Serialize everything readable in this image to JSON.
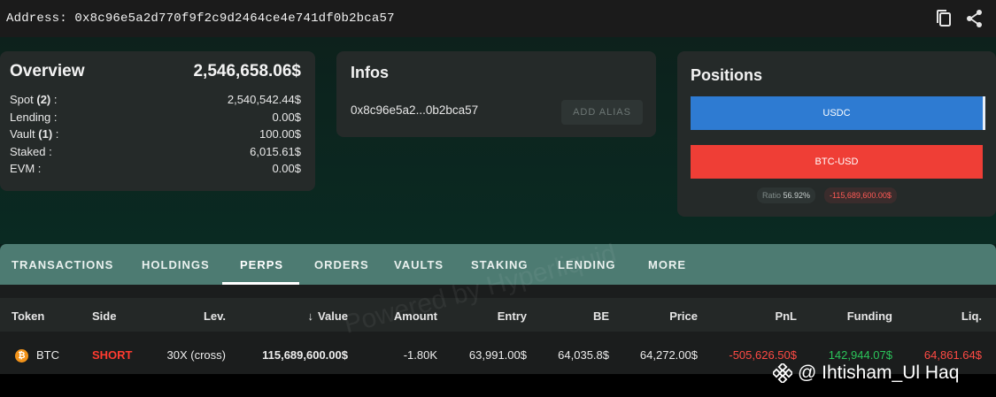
{
  "header": {
    "address_label": "Address:",
    "address": "0x8c96e5a2d770f9f2c9d2464ce4e741df0b2bca57",
    "icons": [
      "copy-icon",
      "share-icon"
    ]
  },
  "overview": {
    "title": "Overview",
    "total": "2,546,658.06$",
    "rows": [
      {
        "label": "Spot",
        "count": "(2)",
        "suffix": " :",
        "value": "2,540,542.44$"
      },
      {
        "label": "Lending",
        "count": "",
        "suffix": " :",
        "value": "0.00$"
      },
      {
        "label": "Vault",
        "count": "(1)",
        "suffix": " :",
        "value": "100.00$"
      },
      {
        "label": "Staked",
        "count": "",
        "suffix": " :",
        "value": "6,015.61$"
      },
      {
        "label": "EVM",
        "count": "",
        "suffix": " :",
        "value": "0.00$"
      }
    ]
  },
  "infos": {
    "title": "Infos",
    "short_address": "0x8c96e5a2...0b2bca57",
    "add_alias_label": "ADD ALIAS"
  },
  "positions": {
    "title": "Positions",
    "bars": [
      "USDC",
      "BTC-USD"
    ],
    "ratio_label": "Ratio",
    "ratio_value": "56.92%",
    "net_value": "-115,689,600.00$"
  },
  "tabs": [
    "TRANSACTIONS",
    "HOLDINGS",
    "PERPS",
    "ORDERS",
    "VAULTS",
    "STAKING",
    "LENDING",
    "MORE"
  ],
  "active_tab": "PERPS",
  "table": {
    "columns": [
      "Token",
      "Side",
      "Lev.",
      "Value",
      "Amount",
      "Entry",
      "BE",
      "Price",
      "PnL",
      "Funding",
      "Liq."
    ],
    "sort_arrow": "↓",
    "rows": [
      {
        "token": "BTC",
        "side": "SHORT",
        "lev": "30X (cross)",
        "value": "115,689,600.00$",
        "amount": "-1.80K",
        "entry": "63,991.00$",
        "be": "64,035.8$",
        "price": "64,272.00$",
        "pnl": "-505,626.50$",
        "funding": "142,944.07$",
        "liq": "64,861.64$"
      }
    ]
  },
  "watermark": "Powered by Hyperliquid",
  "credit": "@ Ihtisham_Ul Haq",
  "colors": {
    "accent_tab": "#4d7b72",
    "usdc": "#2e7bd2",
    "btc": "#ef3e36",
    "negative": "#ff4a44",
    "positive": "#2bc45a"
  }
}
